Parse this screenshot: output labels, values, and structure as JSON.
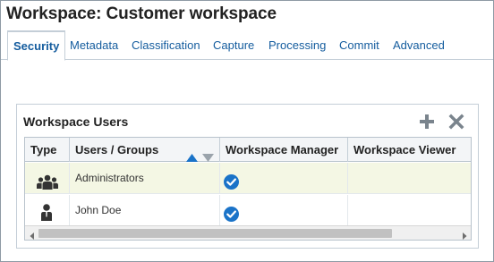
{
  "title": "Workspace: Customer workspace",
  "tabs": [
    {
      "label": "Security",
      "active": true
    },
    {
      "label": "Metadata"
    },
    {
      "label": "Classification"
    },
    {
      "label": "Capture"
    },
    {
      "label": "Processing"
    },
    {
      "label": "Commit"
    },
    {
      "label": "Advanced"
    }
  ],
  "panel": {
    "title": "Workspace Users",
    "add_icon": "plus-icon",
    "remove_icon": "close-x-icon"
  },
  "table": {
    "columns": [
      "Type",
      "Users / Groups",
      "Workspace Manager",
      "Workspace Viewer"
    ],
    "sort_icons": [
      "sort-ascending-icon",
      "sort-descending-icon"
    ],
    "rows": [
      {
        "type_icon": "group-icon",
        "name": "Administrators",
        "manager": true,
        "viewer": false,
        "selected": true
      },
      {
        "type_icon": "user-icon",
        "name": "John Doe",
        "manager": true,
        "viewer": false,
        "selected": false
      }
    ]
  },
  "colors": {
    "accent": "#145c9e",
    "check": "#1a73c8",
    "sort_active": "#1a73c8",
    "selected_row": "#f4f7e4",
    "icon_gray": "#7a848d"
  }
}
